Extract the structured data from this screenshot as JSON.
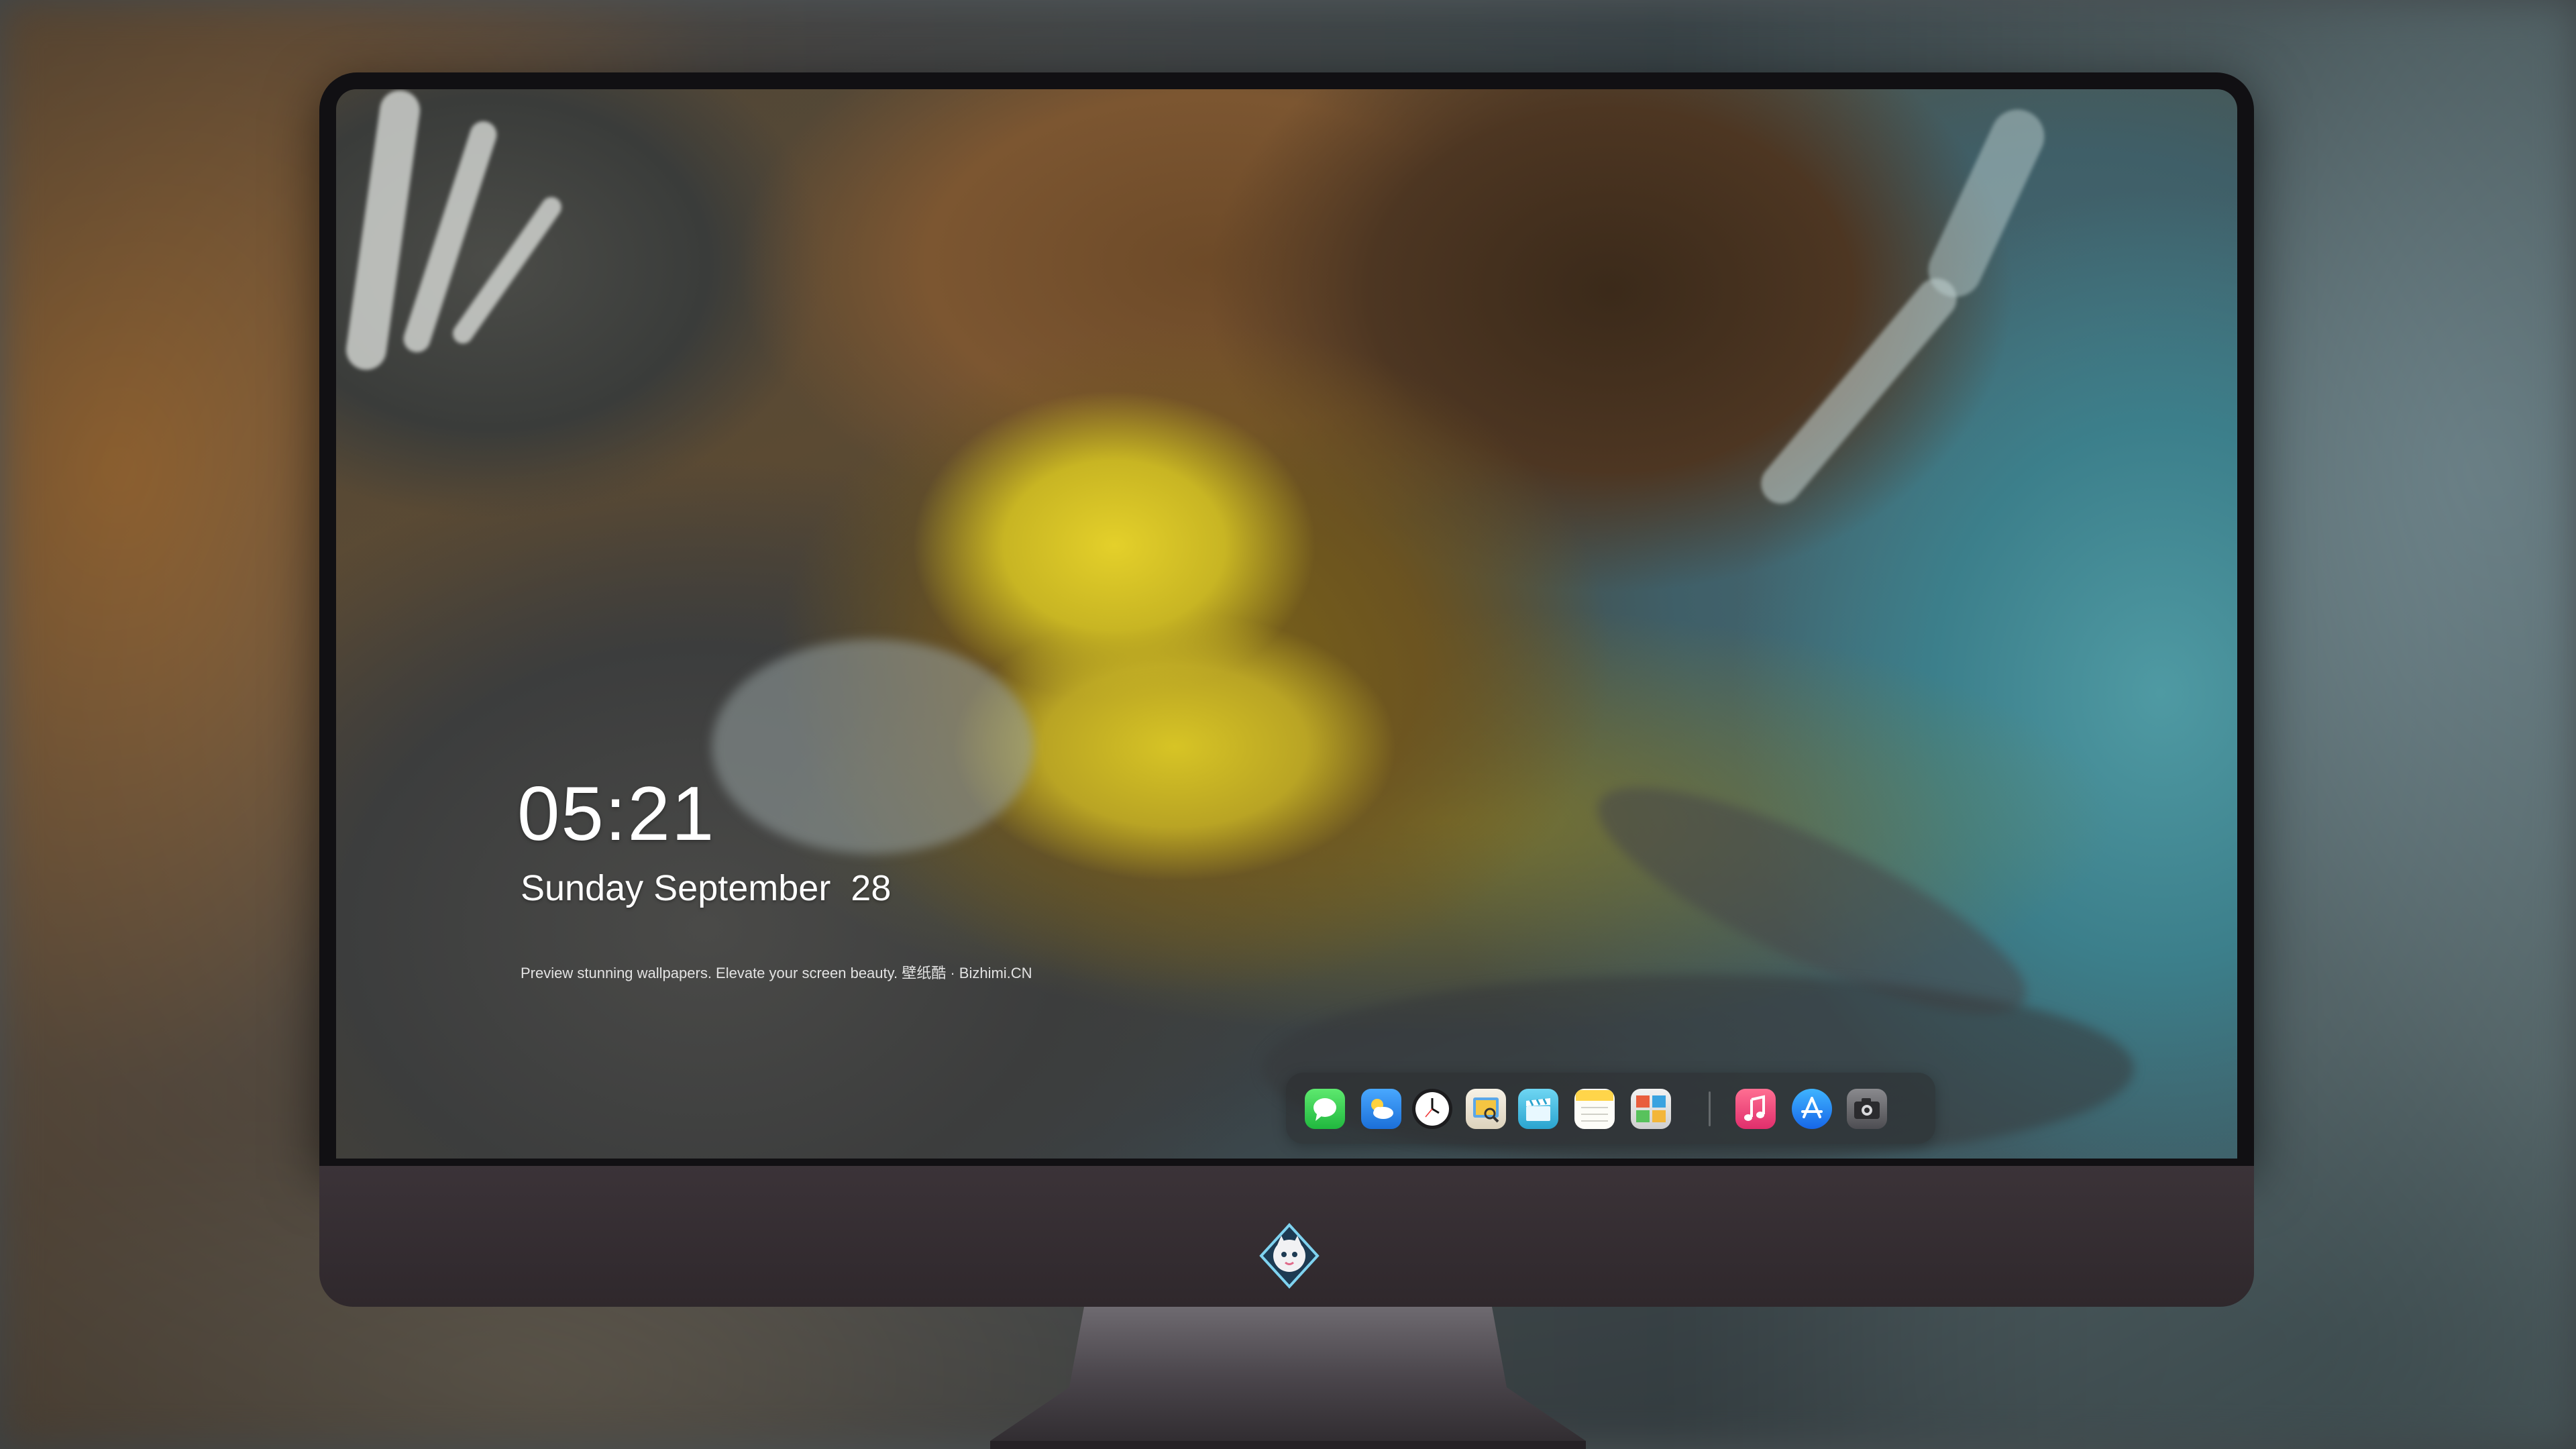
{
  "lock_screen": {
    "time": "05:21",
    "date": "Sunday September  28",
    "caption": "Preview stunning wallpapers. Elevate your screen beauty. 壁纸酷 · Bizhimi.CN"
  },
  "dock": {
    "items": [
      {
        "id": "messages",
        "icon": "messages-icon",
        "color": "#2fcf4f"
      },
      {
        "id": "weather",
        "icon": "weather-icon",
        "color": "#1e8ff0"
      },
      {
        "id": "clock",
        "icon": "clock-icon",
        "color": "#ffffff"
      },
      {
        "id": "preview",
        "icon": "preview-icon",
        "color": "#f4c542"
      },
      {
        "id": "clips",
        "icon": "clapperboard-icon",
        "color": "#3bb6d8"
      },
      {
        "id": "notes",
        "icon": "notes-icon",
        "color": "#ffd54a"
      },
      {
        "id": "photo-booth",
        "icon": "photo-booth-icon",
        "color": "#e95d3d"
      },
      {
        "id": "music",
        "icon": "music-icon",
        "color": "#f2477b"
      },
      {
        "id": "app-store",
        "icon": "app-store-icon",
        "color": "#1c7cf4"
      },
      {
        "id": "camera",
        "icon": "camera-icon",
        "color": "#6a6a6e"
      }
    ]
  },
  "monitor": {
    "chin_logo": "mascot-logo-icon",
    "bezel_color": "#111013",
    "chin_color": "#3b3338"
  }
}
